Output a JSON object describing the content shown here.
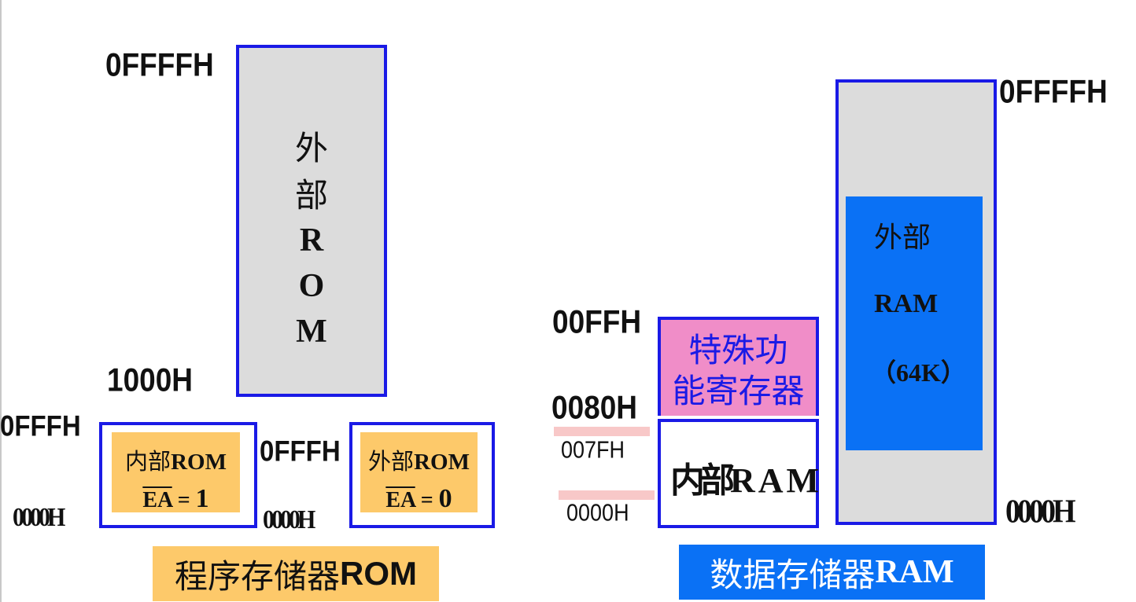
{
  "rom_side": {
    "external_rom": {
      "label_chars": [
        "外",
        "部",
        "R",
        "O",
        "M"
      ],
      "top_address": "0FFFFH",
      "bottom_address": "1000H"
    },
    "internal_rom_ea1": {
      "top_address": "0FFFH",
      "bottom_address": "0000H",
      "title_cjk": "内部",
      "title_latin": "ROM",
      "ea_signal": "EA",
      "ea_equals": "= ",
      "ea_value": "1"
    },
    "external_rom_ea0": {
      "top_address": "0FFFH",
      "bottom_address": "0000H",
      "title_cjk": "外部",
      "title_latin": "ROM",
      "ea_signal": "EA",
      "ea_equals": "= ",
      "ea_value": "0"
    },
    "caption_cjk": "程序存储器",
    "caption_latin": "ROM"
  },
  "ram_side": {
    "sfr": {
      "line1": "特殊功",
      "line2": "能寄存器",
      "top_address": "00FFH",
      "bottom_address": "0080H"
    },
    "internal_ram": {
      "label_cjk": "内部",
      "label_latin": "RAM",
      "top_address": "007FH",
      "bottom_address": "0000H"
    },
    "external_ram": {
      "label_cjk": "外部",
      "label_latin": "RAM",
      "size": "（64K）",
      "top_address": "0FFFFH",
      "bottom_address": "0000H"
    },
    "caption_cjk": "数据存储器",
    "caption_latin": "RAM"
  },
  "colors": {
    "border_blue": "#1a1ae6",
    "rom_gray": "#dcdcdc",
    "orange": "#fdc96a",
    "pink": "#f08dc8",
    "bright_blue": "#0a71f5"
  }
}
